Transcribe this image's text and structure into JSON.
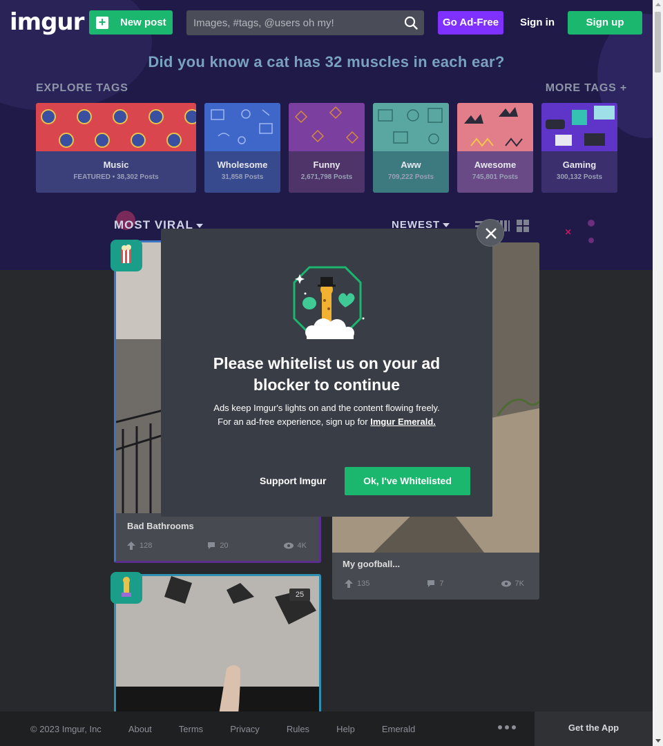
{
  "header": {
    "logo_text": "imgur",
    "new_post_label": "New post",
    "search_placeholder": "Images, #tags, @users oh my!",
    "go_ad_free_label": "Go Ad-Free",
    "sign_in_label": "Sign in",
    "sign_up_label": "Sign up"
  },
  "fact": "Did you know a cat has 32 muscles in each ear?",
  "explore": {
    "title": "EXPLORE TAGS",
    "more_label": "MORE TAGS +",
    "tags": [
      {
        "name": "Music",
        "count": "FEATURED • 38,302 Posts",
        "color": "#d9464e",
        "info_color": "#3b3f7a"
      },
      {
        "name": "Wholesome",
        "count": "31,858 Posts",
        "color": "#3f67c9",
        "info_color": "#374a8e"
      },
      {
        "name": "Funny",
        "count": "2,671,798 Posts",
        "color": "#7b3fa0",
        "info_color": "#4e3468"
      },
      {
        "name": "Aww",
        "count": "709,222 Posts",
        "color": "#5aa7a2",
        "info_color": "#3d7a80"
      },
      {
        "name": "Awesome",
        "count": "745,801 Posts",
        "color": "#e27d8a",
        "info_color": "#6a4a86"
      },
      {
        "name": "Gaming",
        "count": "300,132 Posts",
        "color": "#5e35c8",
        "info_color": "#3c2f6e"
      }
    ]
  },
  "sort": {
    "section_label": "MOST VIRAL",
    "order_label": "NEWEST"
  },
  "posts": [
    {
      "title": "Bad Bathrooms",
      "upvotes": "128",
      "comments": "20",
      "views": "4K"
    },
    {
      "title": "My goofball...",
      "upvotes": "135",
      "comments": "7",
      "views": "7K"
    },
    {
      "image_count": "25"
    }
  ],
  "modal": {
    "heading": "Please whitelist us on your ad blocker to continue",
    "line1": "Ads keep Imgur's lights on and the content flowing freely.",
    "line2_prefix": "For an ad-free experience, sign up for",
    "emerald_link": "Imgur Emerald.",
    "support_label": "Support Imgur",
    "ok_label": "Ok, I've Whitelisted"
  },
  "footer": {
    "copyright": "© 2023 Imgur, Inc",
    "links": [
      "About",
      "Terms",
      "Privacy",
      "Rules",
      "Help",
      "Emerald"
    ],
    "get_app_label": "Get the App"
  },
  "colors": {
    "brand_green": "#1bb76e",
    "ad_free_purple": "#7f32ff",
    "hero_bg": "#1f1a48",
    "page_bg": "#27292d"
  }
}
